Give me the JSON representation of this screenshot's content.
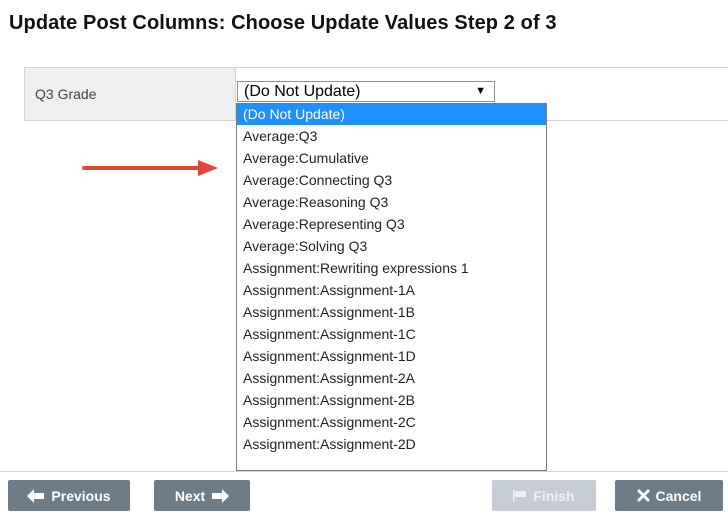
{
  "page": {
    "title": "Update Post Columns: Choose Update Values  Step 2 of 3"
  },
  "form": {
    "field_label": "Q3 Grade",
    "select_value": "(Do Not Update)",
    "select_caret": "▼",
    "options": [
      "(Do Not Update)",
      "Average:Q3",
      "Average:Cumulative",
      "Average:Connecting Q3",
      "Average:Reasoning Q3",
      "Average:Representing Q3",
      "Average:Solving Q3",
      "Assignment:Rewriting expressions 1",
      "Assignment:Assignment-1A",
      "Assignment:Assignment-1B",
      "Assignment:Assignment-1C",
      "Assignment:Assignment-1D",
      "Assignment:Assignment-2A",
      "Assignment:Assignment-2B",
      "Assignment:Assignment-2C",
      "Assignment:Assignment-2D"
    ],
    "selected_index": 0
  },
  "annotation": {
    "arrow_color": "#e0473a",
    "points_to": "Average:Cumulative"
  },
  "footer": {
    "previous_label": "Previous",
    "next_label": "Next",
    "finish_label": "Finish",
    "cancel_label": "Cancel",
    "previous_icon": "arrow-left-icon",
    "next_icon": "arrow-right-icon",
    "finish_icon": "flag-icon",
    "cancel_icon": "x-icon"
  },
  "colors": {
    "selected_option_bg": "#1e90ff",
    "button_bg": "#6e7c87",
    "button_disabled_bg": "#c5ccd3"
  }
}
